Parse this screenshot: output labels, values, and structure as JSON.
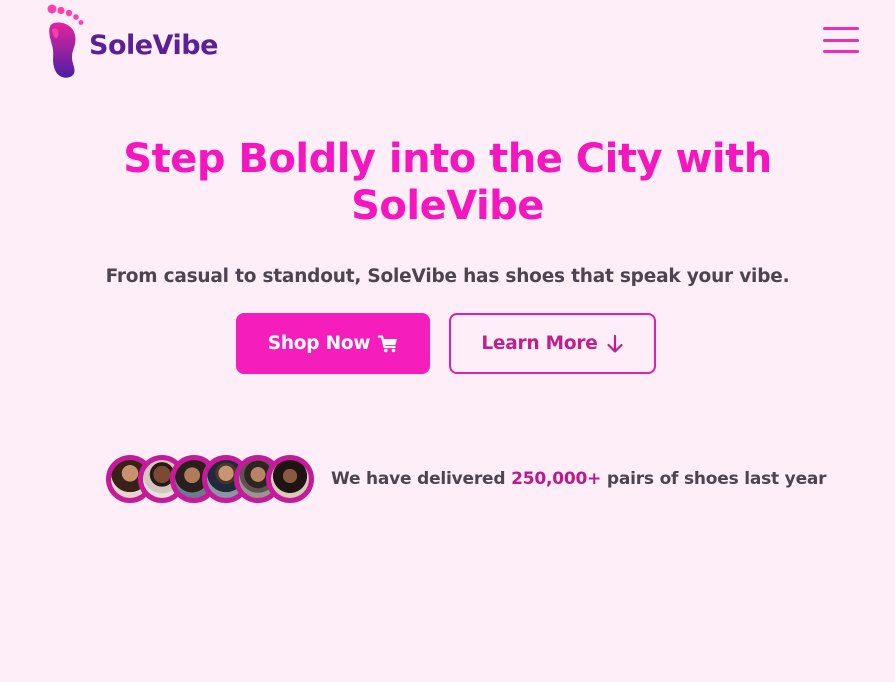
{
  "brand": {
    "name": "SoleVibe",
    "logo_icon": "footprint-icon",
    "colors": {
      "primary": "#f516bf",
      "logo_text": "#5b2096",
      "accent_dark": "#c2168e",
      "background": "#fdeef8"
    }
  },
  "header": {
    "menu_icon": "hamburger-menu-icon"
  },
  "hero": {
    "title_line1": "Step Boldly into the City with",
    "title_line2": "SoleVibe",
    "subtitle": "From casual to standout, SoleVibe has shoes that speak your vibe.",
    "primary_button": {
      "label": "Shop Now",
      "icon": "cart-icon"
    },
    "secondary_button": {
      "label": "Learn More",
      "icon": "arrow-down-icon"
    }
  },
  "social_proof": {
    "prefix": "We have delivered",
    "highlight": "250,000+",
    "suffix": "pairs of shoes last year",
    "avatars": [
      {
        "name": "customer-avatar-1"
      },
      {
        "name": "customer-avatar-2"
      },
      {
        "name": "customer-avatar-3"
      },
      {
        "name": "customer-avatar-4"
      },
      {
        "name": "customer-avatar-5"
      },
      {
        "name": "customer-avatar-6"
      }
    ]
  }
}
